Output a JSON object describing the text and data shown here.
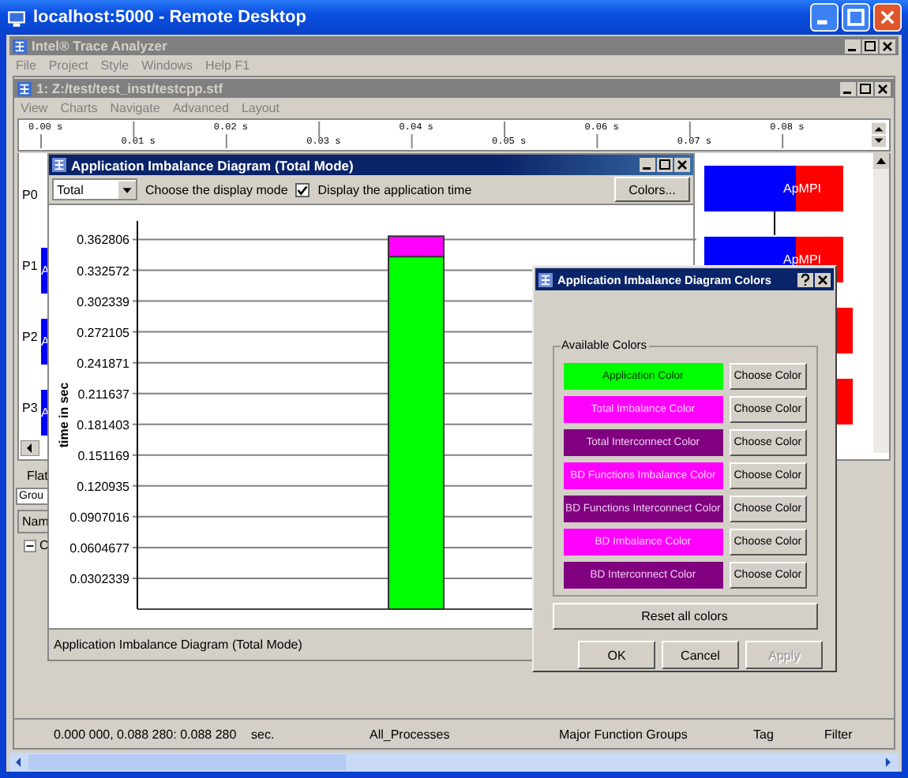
{
  "remote_window": {
    "title": "localhost:5000 - Remote Desktop"
  },
  "app": {
    "title": "Intel® Trace Analyzer",
    "menu": [
      "File",
      "Project",
      "Style",
      "Windows",
      "Help F1"
    ]
  },
  "document": {
    "title": "1: Z:/test/test_inst/testcpp.stf",
    "menu": [
      "View",
      "Charts",
      "Navigate",
      "Advanced",
      "Layout"
    ],
    "ruler": [
      "0.00 s",
      "0.01 s",
      "0.02 s",
      "0.03 s",
      "0.04 s",
      "0.05 s",
      "0.06 s",
      "0.07 s",
      "0.08 s"
    ]
  },
  "timeline": {
    "processes": [
      {
        "label": "P0",
        "right_text": "ApMPI"
      },
      {
        "label": "P1",
        "left_text": "A",
        "right_text": "ApMPI"
      },
      {
        "label": "P2",
        "left_text": "A"
      },
      {
        "label": "P3",
        "left_text": "A"
      }
    ]
  },
  "bottom_panel": {
    "tab": "Flat",
    "group_field": "Grou",
    "column": "Nam",
    "tree": [
      {
        "label": "C",
        "expanded": true
      }
    ]
  },
  "status_bar": [
    "0.000 000, 0.088 280: 0.088 280",
    "sec.",
    "All_Processes",
    "Major Function Groups",
    "Tag",
    "Filter"
  ],
  "imbalance_window": {
    "title": "Application Imbalance Diagram (Total Mode)",
    "mode": "Total",
    "mode_hint": "Choose the display mode",
    "show_app_time": {
      "label": "Display the application time",
      "checked": true
    },
    "colors_button": "Colors...",
    "chart_data": {
      "type": "bar",
      "ylabel": "time in sec",
      "stacked": true,
      "grid": true,
      "ylim": [
        0,
        0.381
      ],
      "yticks": [
        0.0302339,
        0.0604677,
        0.0907016,
        0.120935,
        0.151169,
        0.181403,
        0.211637,
        0.241871,
        0.272105,
        0.302339,
        0.332572,
        0.362806
      ],
      "series": [
        {
          "color": "#00ff00",
          "values": [
            0.346
          ]
        },
        {
          "color": "#ff00ff",
          "values": [
            0.02
          ]
        }
      ]
    },
    "footer": "Application Imbalance Diagram (Total Mode)"
  },
  "colors_dialog": {
    "title": "Application Imbalance Diagram Colors",
    "group": "Available Colors",
    "colors": [
      {
        "label": "Application Color",
        "color": "#00ff00",
        "button": "Choose Color"
      },
      {
        "label": "Total Imbalance Color",
        "color": "#ff00ff",
        "button": "Choose Color"
      },
      {
        "label": "Total Interconnect Color",
        "color": "#800080",
        "button": "Choose Color"
      },
      {
        "label": "BD Functions Imbalance Color",
        "color": "#ff00ff",
        "button": "Choose Color"
      },
      {
        "label": "BD Functions Interconnect Color",
        "color": "#800080",
        "button": "Choose Color"
      },
      {
        "label": "BD Imbalance Color",
        "color": "#ff00ff",
        "button": "Choose Color"
      },
      {
        "label": "BD Interconnect Color",
        "color": "#800080",
        "button": "Choose Color"
      }
    ],
    "reset": "Reset all colors",
    "buttons": [
      {
        "label": "OK",
        "disabled": false
      },
      {
        "label": "Cancel",
        "disabled": false
      },
      {
        "label": "Apply",
        "disabled": true
      }
    ]
  }
}
